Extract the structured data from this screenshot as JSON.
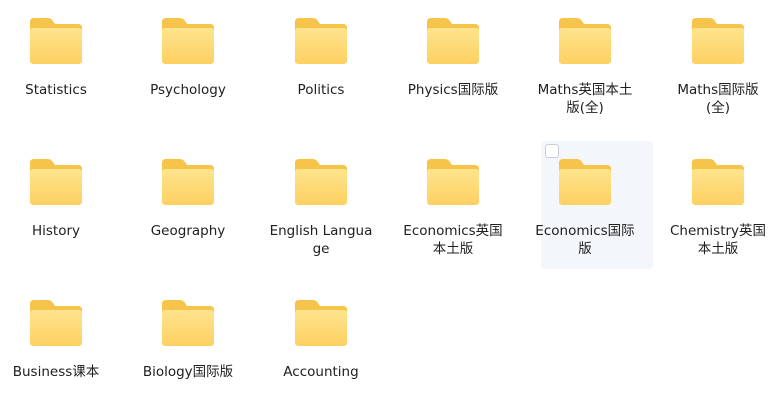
{
  "folders": [
    {
      "label": "Statistics",
      "icon": "folder-icon"
    },
    {
      "label": "Psychology",
      "icon": "folder-icon"
    },
    {
      "label": "Politics",
      "icon": "folder-icon"
    },
    {
      "label": "Physics国际版",
      "icon": "folder-icon"
    },
    {
      "label": "Maths英国本土版(全)",
      "icon": "folder-icon"
    },
    {
      "label": "Maths国际版(全)",
      "icon": "folder-icon"
    },
    {
      "label": "History",
      "icon": "folder-icon"
    },
    {
      "label": "Geography",
      "icon": "folder-icon"
    },
    {
      "label": "English Language",
      "icon": "folder-icon"
    },
    {
      "label": "Economics英国本土版",
      "icon": "folder-icon"
    },
    {
      "label": "Economics国际版",
      "icon": "folder-icon",
      "hovered": true
    },
    {
      "label": "Chemistry英国本土版",
      "icon": "folder-icon"
    },
    {
      "label": "Business课本",
      "icon": "folder-icon"
    },
    {
      "label": "Biology国际版",
      "icon": "folder-icon"
    },
    {
      "label": "Accounting",
      "icon": "folder-icon"
    }
  ],
  "colors": {
    "folder_back": "#f6c44a",
    "folder_front_top": "#ffe48d",
    "folder_front_bottom": "#fdd062",
    "hover_bg": "#f3f6fb"
  }
}
